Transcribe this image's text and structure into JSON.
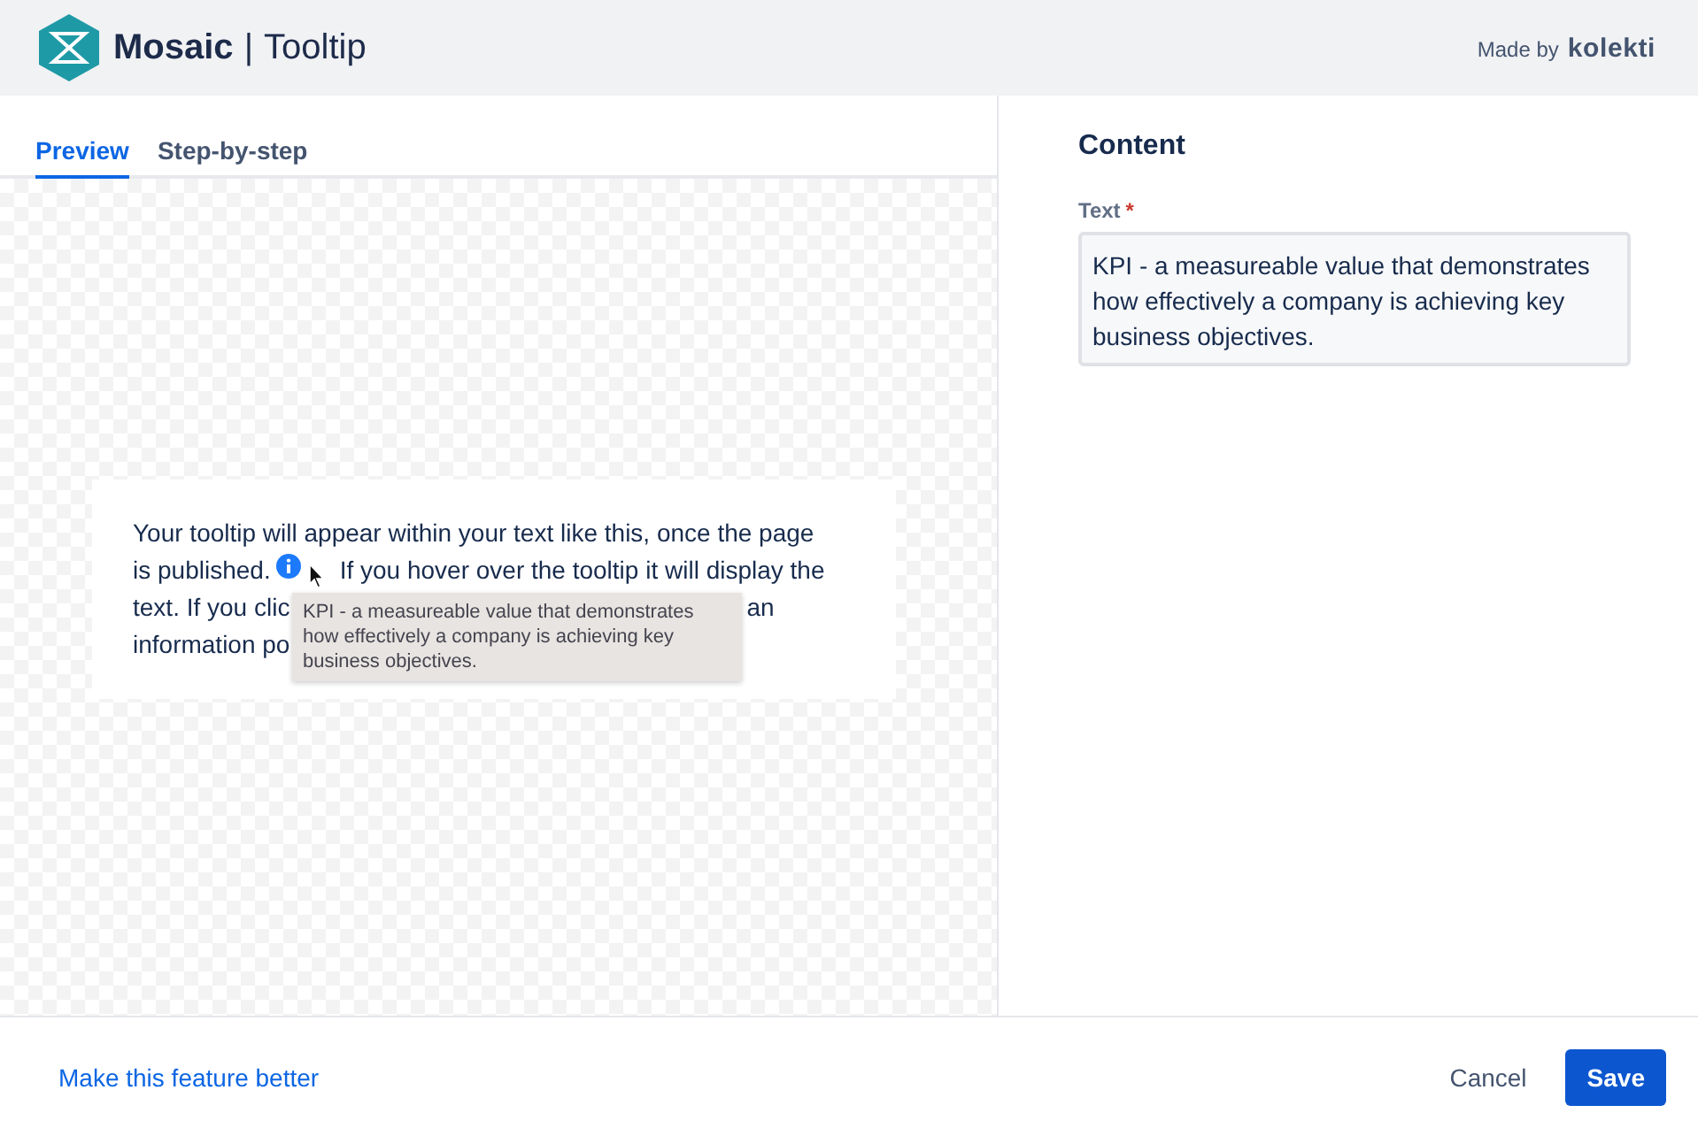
{
  "header": {
    "brand": "Mosaic",
    "separator": "|",
    "product": "Tooltip",
    "made_by": "Made by",
    "maker": "kolekti"
  },
  "tabs": [
    {
      "label": "Preview",
      "selected": true
    },
    {
      "label": "Step-by-step",
      "selected": false
    }
  ],
  "preview": {
    "lines": [
      {
        "before": "Your tooltip will appear within your text like this, once the page"
      },
      {
        "before": "is published.",
        "info_icon": true,
        "after": "If you hover over the tooltip it will display the"
      },
      {
        "before": "text. If you clic",
        "after": "an"
      },
      {
        "before": "information po"
      }
    ],
    "tooltip": "KPI - a measureable value that demonstrates how effectively a company is achieving key business objectives."
  },
  "content": {
    "title": "Content",
    "field_label": "Text",
    "required_mark": "*",
    "value": "KPI - a measureable value that demonstrates how effectively a company is achieving key business objectives."
  },
  "footer": {
    "link": "Make this feature better",
    "cancel": "Cancel",
    "save": "Save"
  }
}
